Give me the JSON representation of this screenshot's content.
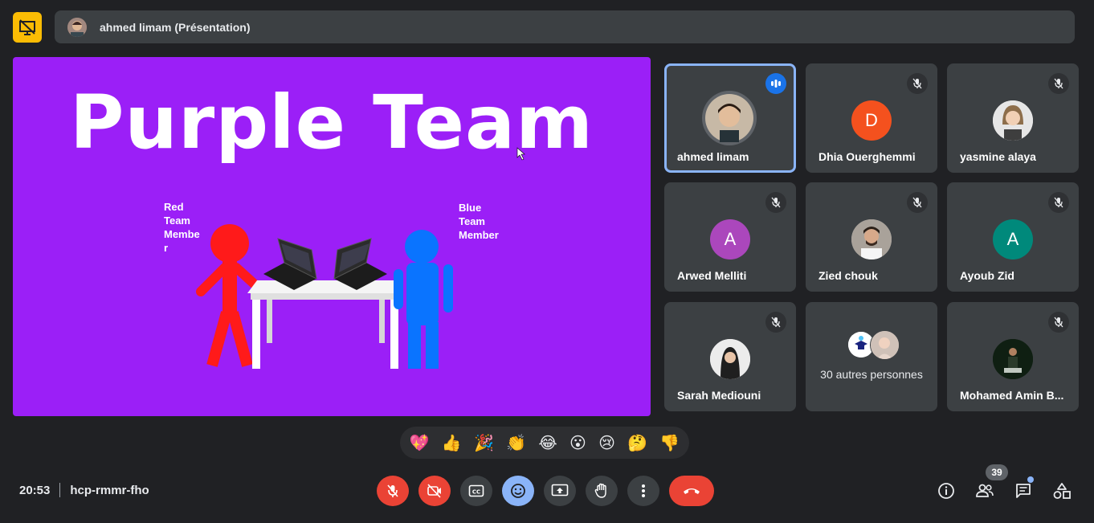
{
  "header": {
    "presenter_title": "ahmed limam (Présentation)",
    "presenting_icon": "presentation-off-icon"
  },
  "slide": {
    "title": "Purple Team",
    "red_label": "Red\nTeam\nMembe\nr",
    "blue_label": "Blue\nTeam\nMember",
    "background": "#9b1ff7"
  },
  "participants": [
    {
      "name": "ahmed limam",
      "avatar": "photo",
      "status": "speaking"
    },
    {
      "name": "Dhia Ouerghemmi",
      "initial": "D",
      "color": "#f4511e",
      "status": "muted"
    },
    {
      "name": "yasmine alaya",
      "avatar": "photo",
      "status": "muted"
    },
    {
      "name": "Arwed Melliti",
      "initial": "A",
      "color": "#ab47bc",
      "status": "muted"
    },
    {
      "name": "Zied chouk",
      "avatar": "photo",
      "status": "muted"
    },
    {
      "name": "Ayoub Zid",
      "initial": "A",
      "color": "#00897b",
      "status": "muted"
    },
    {
      "name": "Sarah Mediouni",
      "avatar": "photo",
      "status": "muted"
    },
    {
      "name": "Mohamed Amin B...",
      "avatar": "photo",
      "status": "muted"
    }
  ],
  "others": {
    "label": "30 autres personnes"
  },
  "reactions": [
    "💖",
    "👍",
    "🎉",
    "👏",
    "😂",
    "😮",
    "😢",
    "🤔",
    "👎"
  ],
  "footer": {
    "time": "20:53",
    "meeting_code": "hcp-rmmr-fho",
    "people_count": "39"
  },
  "colors": {
    "accent": "#8ab4f8",
    "danger": "#ea4335",
    "surface": "#3c4043",
    "background": "#202124"
  }
}
